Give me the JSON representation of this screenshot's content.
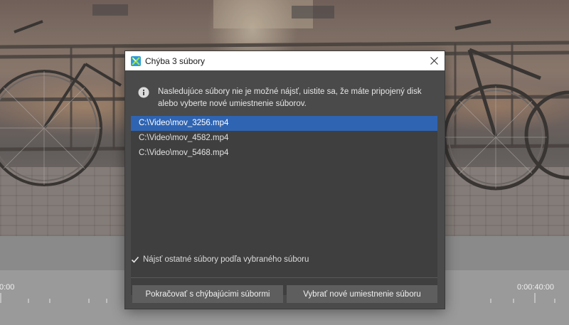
{
  "dialog": {
    "title": "Chýba 3 súbory",
    "app_icon": "app-logo-icon",
    "close_icon": "close-icon",
    "message": "Nasledujúce súbory nie je možné nájsť, uistite sa, že máte pripojený disk alebo vyberte nové umiestnenie súborov.",
    "info_icon": "info-icon",
    "files": [
      {
        "path": "C:\\Video\\mov_3256.mp4",
        "selected": true
      },
      {
        "path": "C:\\Video\\mov_4582.mp4",
        "selected": false
      },
      {
        "path": "C:\\Video\\mov_5468.mp4",
        "selected": false
      }
    ],
    "option": {
      "label": "Nájsť ostatné súbory podľa vybraného súboru",
      "checked": true
    },
    "buttons": {
      "continue_label": "Pokračovať s chýbajúcimi súbormi",
      "relocate_label": "Vybrať nové umiestnenie súboru"
    }
  },
  "timeline": {
    "start_label": "0:00",
    "end_label": "0:00:40:00"
  },
  "colors": {
    "dialog_bg": "#4a4a4a",
    "list_bg": "#3f3f3f",
    "selection": "#2f64b2",
    "button_bg": "#5e5e5e",
    "titlebar_bg": "#ffffff"
  }
}
